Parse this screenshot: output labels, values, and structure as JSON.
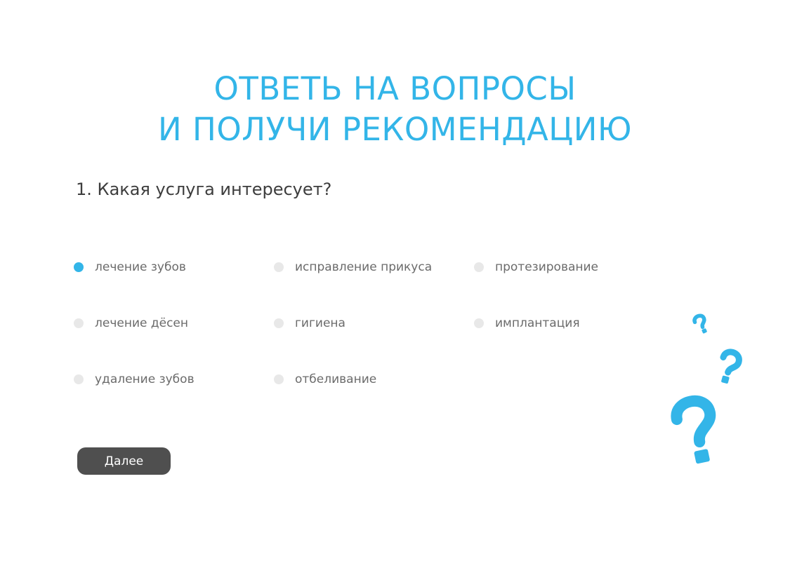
{
  "header": {
    "title_line1": "ОТВЕТЬ НА ВОПРОСЫ",
    "title_line2": "И ПОЛУЧИ РЕКОМЕНДАЦИЮ"
  },
  "quiz": {
    "question": "1. Какая услуга интересует?",
    "selected_option": "лечение зубов",
    "options": [
      {
        "label": "лечение зубов",
        "checked": true
      },
      {
        "label": "исправление прикуса",
        "checked": false
      },
      {
        "label": "протезирование",
        "checked": false
      },
      {
        "label": "лечение дёсен",
        "checked": false
      },
      {
        "label": "гигиена",
        "checked": false
      },
      {
        "label": "имплантация",
        "checked": false
      },
      {
        "label": "удаление зубов",
        "checked": false
      },
      {
        "label": "отбеливание",
        "checked": false
      }
    ],
    "next_label": "Далее"
  },
  "colors": {
    "accent": "#33b5e8",
    "radio_inactive": "#e8e8e8",
    "button_bg": "#4f4f4f",
    "question_text": "#3d3d3d",
    "option_text": "#6b6b6b"
  },
  "decoration": {
    "icon": "question-mark-icon"
  }
}
